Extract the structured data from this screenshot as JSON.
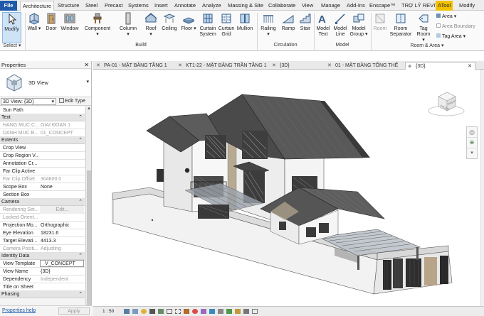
{
  "ribbon_tabs": [
    {
      "label": "File"
    },
    {
      "label": "Architecture"
    },
    {
      "label": "Structure"
    },
    {
      "label": "Steel"
    },
    {
      "label": "Precast"
    },
    {
      "label": "Systems"
    },
    {
      "label": "Insert"
    },
    {
      "label": "Annotate"
    },
    {
      "label": "Analyze"
    },
    {
      "label": "Massing & Site"
    },
    {
      "label": "Collaborate"
    },
    {
      "label": "View"
    },
    {
      "label": "Manage"
    },
    {
      "label": "Add-Ins"
    },
    {
      "label": "Enscape™"
    },
    {
      "label": "TRỢ LÝ REVIT"
    },
    {
      "label": "ATool"
    },
    {
      "label": "Modify"
    }
  ],
  "ribbon": {
    "modify": "Modify",
    "select": "Select",
    "build": {
      "label": "Build",
      "wall": "Wall",
      "door": "Door",
      "window": "Window",
      "component": "Component",
      "column": "Column",
      "roof": "Roof",
      "ceiling": "Ceiling",
      "floor": "Floor",
      "curtain_system_1": "Curtain",
      "curtain_system_2": "System",
      "curtain_grid_1": "Curtain",
      "curtain_grid_2": "Grid",
      "mullion": "Mullion"
    },
    "circulation": {
      "label": "Circulation",
      "railing": "Railing",
      "ramp": "Ramp",
      "stair": "Stair"
    },
    "model": {
      "label": "Model",
      "model_text_1": "Model",
      "model_text_2": "Text",
      "model_line_1": "Model",
      "model_line_2": "Line",
      "model_group_1": "Model",
      "model_group_2": "Group"
    },
    "room_area": {
      "label": "Room & Area",
      "room": "Room",
      "room_sep_1": "Room",
      "room_sep_2": "Separator",
      "tag_room_1": "Tag",
      "tag_room_2": "Room",
      "area": "Area",
      "area_boundary": "Area  Boundary",
      "tag_area": "Tag  Area"
    }
  },
  "properties": {
    "title": "Properties",
    "type_name": "3D View",
    "instance_selector": "3D View: {3D}",
    "edit_type": "Edit Type",
    "help": "Properties help",
    "apply": "Apply",
    "sun_path": "Sun Path",
    "sections": {
      "text": "Text",
      "extents": "Extents",
      "camera": "Camera",
      "identity": "Identity Data",
      "phasing": "Phasing"
    },
    "text_rows": [
      {
        "k": "HANG MUC C...",
        "v": "GIAI ĐOẠN 1"
      },
      {
        "k": "DANH MUC B...",
        "v": "01_CONCEPT"
      }
    ],
    "extents_rows": [
      {
        "k": "Crop View",
        "v": ""
      },
      {
        "k": "Crop Region V...",
        "v": ""
      },
      {
        "k": "Annotation Cr...",
        "v": ""
      },
      {
        "k": "Far Clip Active",
        "v": ""
      },
      {
        "k": "Far Clip Offset",
        "v": "304800.0"
      },
      {
        "k": "Scope Box",
        "v": "None"
      },
      {
        "k": "Section Box",
        "v": ""
      }
    ],
    "camera_rows": [
      {
        "k": "Rendering Set...",
        "v": "Edit..."
      },
      {
        "k": "Locked Orient...",
        "v": ""
      },
      {
        "k": "Projection Mo...",
        "v": "Orthographic"
      },
      {
        "k": "Eye Elevation",
        "v": "18231.6"
      },
      {
        "k": "Target Elevati...",
        "v": "4413.3"
      },
      {
        "k": "Camera Positi...",
        "v": "Adjusting"
      }
    ],
    "identity_rows": [
      {
        "k": "View Template",
        "v": "V_CONCEPT"
      },
      {
        "k": "View Name",
        "v": "{3D}"
      },
      {
        "k": "Dependency",
        "v": "Independent"
      },
      {
        "k": "Title on Sheet",
        "v": ""
      }
    ]
  },
  "view_tabs": [
    {
      "label": "PA-01 - MẶT BẰNG TẦNG 1"
    },
    {
      "label": "KT1-22 - MẶT BẰNG TRẦN TẦNG 1"
    },
    {
      "label": "{3D}"
    },
    {
      "label": "01 - MẶT BẰNG TỔNG THỂ"
    },
    {
      "label": "{3D}"
    }
  ],
  "viewcube": {
    "front": "FRONT",
    "right": "RIGHT"
  },
  "status": {
    "scale": "1 : 50"
  }
}
